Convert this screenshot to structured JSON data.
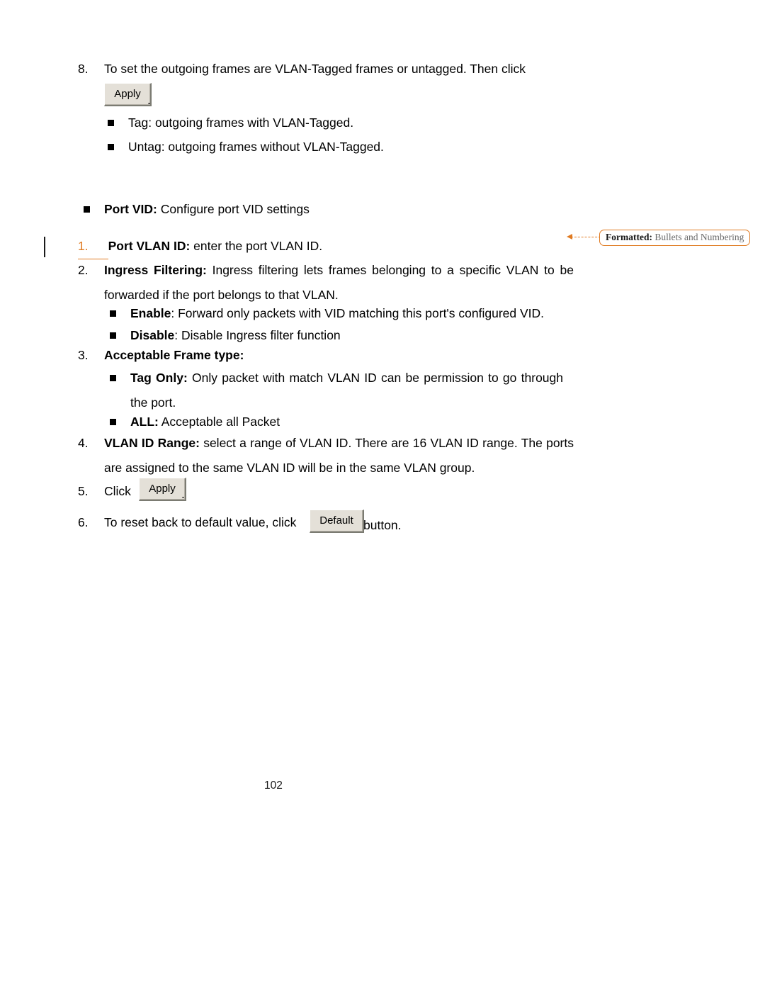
{
  "document": {
    "page_number": "102",
    "accent_color": "#E07B22",
    "text_color": "#000000",
    "background": "#ffffff"
  },
  "items": {
    "step8": {
      "number": "8.",
      "text_before_button": "To set the outgoing frames are VLAN-Tagged frames or untagged. Then click",
      "button_label": "Apply",
      "text_after_button": "."
    },
    "step8_bullets": [
      {
        "bold": "",
        "text": "Tag: outgoing frames with VLAN-Tagged."
      },
      {
        "bold": "",
        "text": "Untag: outgoing frames without VLAN-Tagged."
      }
    ],
    "port_vid_heading": {
      "bold": "Port VID:",
      "text": " Configure port VID settings"
    },
    "step1": {
      "number": "1.",
      "bold": "Port VLAN ID:",
      "text": " enter the port VLAN ID.",
      "tracked_change": "true"
    },
    "step2": {
      "number": "2.",
      "bold": "Ingress Filtering:",
      "text": " Ingress filtering lets frames belonging to a specific VLAN to be forwarded if the port belongs to that VLAN."
    },
    "step2_bullets": [
      {
        "bold": "Enable",
        "text": ": Forward only packets with VID matching this port's configured VID."
      },
      {
        "bold": "Disable",
        "text": ": Disable Ingress filter function"
      }
    ],
    "step3": {
      "number": "3.",
      "bold": "Acceptable Frame type:",
      "text": ""
    },
    "step3_bullets": [
      {
        "bold": "Tag Only:",
        "text": " Only packet with match VLAN ID can be permission to go through the port."
      },
      {
        "bold": "ALL:",
        "text": " Acceptable all Packet"
      }
    ],
    "step4": {
      "number": "4.",
      "bold": "VLAN ID Range:",
      "text": " select a range of VLAN ID. There are 16 VLAN ID range. The ports are assigned to the same VLAN ID will be in the same VLAN group."
    },
    "step5": {
      "number": "5.",
      "text_before_button": "Click",
      "button_label": "Apply",
      "text_after_button": "."
    },
    "step6": {
      "number": "6.",
      "text_before_button": "To reset back to default value, click",
      "button_label": "Default",
      "text_after_button": "button."
    }
  },
  "callout": {
    "label": "Formatted:",
    "value": " Bullets and Numbering"
  }
}
